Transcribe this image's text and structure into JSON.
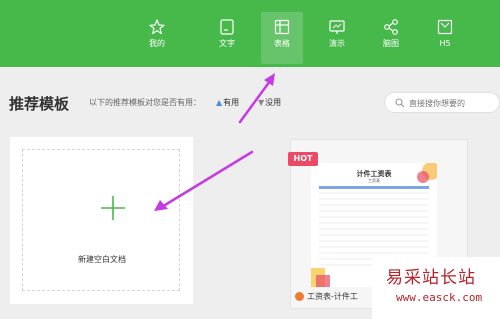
{
  "toolbar": {
    "items": [
      {
        "label": "我的",
        "icon": "star-icon"
      },
      {
        "label": "文字",
        "icon": "document-icon"
      },
      {
        "label": "表格",
        "icon": "table-icon",
        "active": true
      },
      {
        "label": "演示",
        "icon": "presentation-icon"
      },
      {
        "label": "脑图",
        "icon": "mindmap-icon"
      },
      {
        "label": "H5",
        "icon": "h5-icon"
      }
    ],
    "bg_color": "#47b84a"
  },
  "recommend": {
    "title": "推荐模板",
    "hint": "以下的推荐模板对您是否有用：",
    "useful": "有用",
    "useless": "没用"
  },
  "search": {
    "placeholder": "直接搜你想要的"
  },
  "cards": {
    "blank_label": "新建空白文档",
    "template": {
      "badge": "HOT",
      "sheet_title": "计件工资表",
      "sheet_subtitle": "工资表",
      "label": "工资表-计件工"
    }
  },
  "watermark": {
    "text": "易采站长站",
    "url": "www.easck.com"
  },
  "colors": {
    "accent": "#47b84a",
    "hot": "#ea4a66",
    "annotation_arrow": "#c63ae6"
  }
}
